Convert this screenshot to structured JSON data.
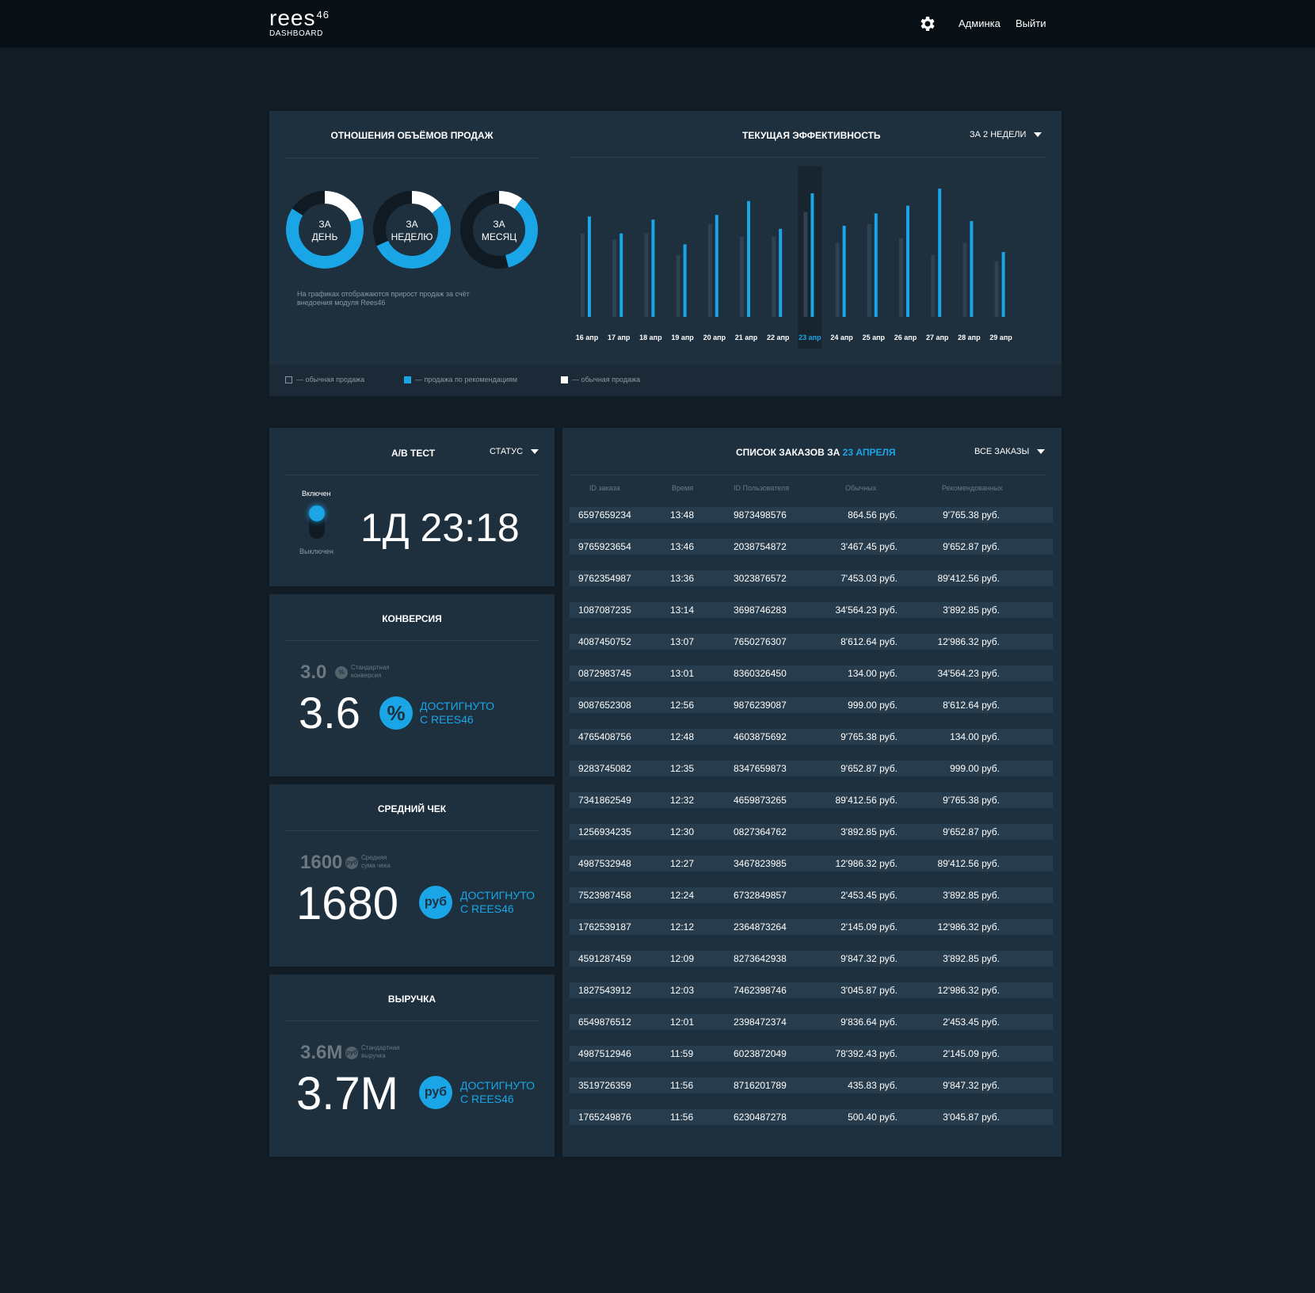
{
  "header": {
    "logo_word": "rees",
    "logo_sup": "46",
    "logo_sub": "DASHBOARD",
    "admin_link": "Админка",
    "logout_link": "Выйти"
  },
  "sales_ratio": {
    "title": "ОТНОШЕНИЯ ОБЪЁМОВ ПРОДАЖ",
    "donuts": [
      {
        "line1": "ЗА",
        "line2": "ДЕНЬ",
        "blue": 0.64,
        "white": 0.2
      },
      {
        "line1": "ЗА",
        "line2": "НЕДЕЛЮ",
        "blue": 0.54,
        "white": 0.14
      },
      {
        "line1": "ЗА",
        "line2": "МЕСЯЦ",
        "blue": 0.36,
        "white": 0.1
      }
    ],
    "note": "На графиках отображаются прирост продаж за счёт внедоения модуля Rees46"
  },
  "efficiency": {
    "title": "ТЕКУЩАЯ  ЭФФЕКТИВНОСТЬ",
    "period": "ЗА 2 НЕДЕЛИ",
    "active_index": 7
  },
  "chart_data": {
    "type": "bar",
    "categories": [
      "16 апр",
      "17 апр",
      "18 апр",
      "19 апр",
      "20 апр",
      "21 апр",
      "22 апр",
      "23 апр",
      "24 апр",
      "25 апр",
      "26 апр",
      "27 апр",
      "28 апр",
      "29 апр"
    ],
    "series": [
      {
        "values": [
          54,
          50,
          54,
          40,
          60,
          52,
          52,
          68,
          48,
          60,
          51,
          40,
          48,
          36
        ]
      },
      {
        "values": [
          65,
          54,
          63,
          47,
          66,
          75,
          57,
          80,
          59,
          67,
          72,
          83,
          62,
          42
        ]
      }
    ],
    "ylim": [
      0,
      100
    ],
    "colors": [
      "#2e4252",
      "#1aa6e6"
    ]
  },
  "legend": [
    {
      "label": "— обычная продажа",
      "color": "#1e2f3d",
      "border": "#8a98a4"
    },
    {
      "label": "— продажа по рекомендациям",
      "color": "#1aa6e6",
      "border": "#1aa6e6"
    },
    {
      "label": "— обычная продажа",
      "color": "#ffffff",
      "border": "#ffffff"
    }
  ],
  "ab_test": {
    "title": "А/В ТЕСТ",
    "status_label": "СТАТУС",
    "on_label": "Включен",
    "off_label": "Выключен",
    "timer": "1Д 23:18",
    "toggle_state": "on"
  },
  "kpis": [
    {
      "title": "КОНВЕРСИЯ",
      "old_value": "3.0",
      "old_icon": "%",
      "old_desc_1": "Стандартная",
      "old_desc_2": "конверсия",
      "new_value": "3.6",
      "badge": "%",
      "ach_1": "ДОСТИГНУТО",
      "ach_2": "С REES46"
    },
    {
      "title": "СРЕДНИЙ ЧЕК",
      "old_value": "1600",
      "old_icon": "руб",
      "old_desc_1": "Средняя",
      "old_desc_2": "сума чека",
      "new_value": "1680",
      "badge": "руб",
      "ach_1": "ДОСТИГНУТО",
      "ach_2": "С REES46"
    },
    {
      "title": "ВЫРУЧКА",
      "old_value": "3.6M",
      "old_icon": "руб",
      "old_desc_1": "Стандартная",
      "old_desc_2": "выручка",
      "new_value": "3.7M",
      "badge": "руб",
      "ach_1": "ДОСТИГНУТО",
      "ach_2": "С REES46"
    }
  ],
  "orders": {
    "title_prefix": "СПИСОК ЗАКАЗОВ ЗА",
    "title_date": "23 АПРЕЛЯ",
    "filter": "ВСЕ  ЗАКАЗЫ",
    "columns": [
      "ID заказа",
      "Время",
      "ID Пользователя",
      "Обычных",
      "Рекомендованных"
    ],
    "rows": [
      [
        "6597659234",
        "13:48",
        "9873498576",
        "864.56 руб.",
        "9'765.38 руб."
      ],
      [
        "9765923654",
        "13:46",
        "2038754872",
        "3'467.45 руб.",
        "9'652.87 руб."
      ],
      [
        "9762354987",
        "13:36",
        "3023876572",
        "7'453.03 руб.",
        "89'412.56 руб."
      ],
      [
        "1087087235",
        "13:14",
        "3698746283",
        "34'564.23 руб.",
        "3'892.85 руб."
      ],
      [
        "4087450752",
        "13:07",
        "7650276307",
        "8'612.64 руб.",
        "12'986.32 руб."
      ],
      [
        "0872983745",
        "13:01",
        "8360326450",
        "134.00 руб.",
        "34'564.23 руб."
      ],
      [
        "9087652308",
        "12:56",
        "9876239087",
        "999.00 руб.",
        "8'612.64 руб."
      ],
      [
        "4765408756",
        "12:48",
        "4603875692",
        "9'765.38 руб.",
        "134.00 руб."
      ],
      [
        "9283745082",
        "12:35",
        "8347659873",
        "9'652.87 руб.",
        "999.00 руб."
      ],
      [
        "7341862549",
        "12:32",
        "4659873265",
        "89'412.56 руб.",
        "9'765.38 руб."
      ],
      [
        "1256934235",
        "12:30",
        "0827364762",
        "3'892.85 руб.",
        "9'652.87 руб."
      ],
      [
        "4987532948",
        "12:27",
        "3467823985",
        "12'986.32 руб.",
        "89'412.56 руб."
      ],
      [
        "7523987458",
        "12:24",
        "6732849857",
        "2'453.45 руб.",
        "3'892.85 руб."
      ],
      [
        "1762539187",
        "12:12",
        "2364873264",
        "2'145.09 руб.",
        "12'986.32 руб."
      ],
      [
        "4591287459",
        "12:09",
        "8273642938",
        "9'847.32 руб.",
        "3'892.85 руб."
      ],
      [
        "1827543912",
        "12:03",
        "7462398746",
        "3'045.87 руб.",
        "12'986.32 руб."
      ],
      [
        "6549876512",
        "12:01",
        "2398472374",
        "9'836.64 руб.",
        "2'453.45 руб."
      ],
      [
        "4987512946",
        "11:59",
        "6023872049",
        "78'392.43 руб.",
        "2'145.09 руб."
      ],
      [
        "3519726359",
        "11:56",
        "8716201789",
        "435.83 руб.",
        "9'847.32 руб."
      ],
      [
        "1765249876",
        "11:56",
        "6230487278",
        "500.40 руб.",
        "3'045.87 руб."
      ]
    ]
  }
}
